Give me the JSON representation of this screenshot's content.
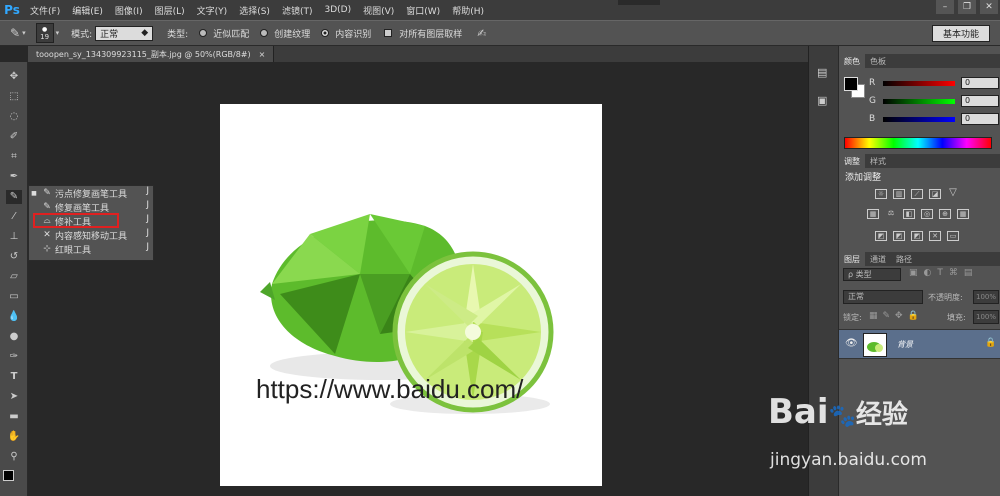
{
  "app": {
    "logo": "Ps"
  },
  "menu": [
    "文件(F)",
    "编辑(E)",
    "图像(I)",
    "图层(L)",
    "文字(Y)",
    "选择(S)",
    "滤镜(T)",
    "3D(D)",
    "视图(V)",
    "窗口(W)",
    "帮助(H)"
  ],
  "window_controls": {
    "minimize": "–",
    "restore": "❐",
    "close": "✕"
  },
  "options": {
    "brush_size": "19",
    "mode_label": "模式:",
    "mode_value": "正常",
    "type_label": "类型:",
    "type_options": [
      "近似匹配",
      "创建纹理",
      "内容识别"
    ],
    "type_selected": "内容识别",
    "sample_all_layers": "对所有图层取样",
    "workspace": "基本功能"
  },
  "document": {
    "tab_title": "tooopen_sy_134309923115_副本.jpg @ 50%(RGB/8#)",
    "close": "×"
  },
  "canvas_text": "https://www.baidu.com/",
  "tool_flyout": {
    "items": [
      {
        "label": "污点修复画笔工具",
        "key": "J"
      },
      {
        "label": "修复画笔工具",
        "key": "J"
      },
      {
        "label": "修补工具",
        "key": "J"
      },
      {
        "label": "内容感知移动工具",
        "key": "J"
      },
      {
        "label": "红眼工具",
        "key": "J"
      }
    ],
    "highlighted": "修补工具"
  },
  "color_panel": {
    "tabs": [
      "颜色",
      "色板"
    ],
    "channels": [
      {
        "name": "R",
        "value": "0",
        "color": "#ff0000"
      },
      {
        "name": "G",
        "value": "0",
        "color": "#00ff00"
      },
      {
        "name": "B",
        "value": "0",
        "color": "#0000ff"
      }
    ]
  },
  "adjust_panel": {
    "tabs": [
      "调整",
      "样式"
    ],
    "title": "添加调整"
  },
  "layers_panel": {
    "tabs": [
      "图层",
      "通道",
      "路径"
    ],
    "filter": "ρ 类型",
    "blend_mode": "正常",
    "opacity_label": "不透明度:",
    "opacity": "100%",
    "lock_label": "锁定:",
    "fill_label": "填充:",
    "fill": "100%",
    "layer_name": "背景"
  },
  "watermark": {
    "brand": "Bai",
    "brand2": "经验",
    "url": "jingyan.baidu.com"
  }
}
